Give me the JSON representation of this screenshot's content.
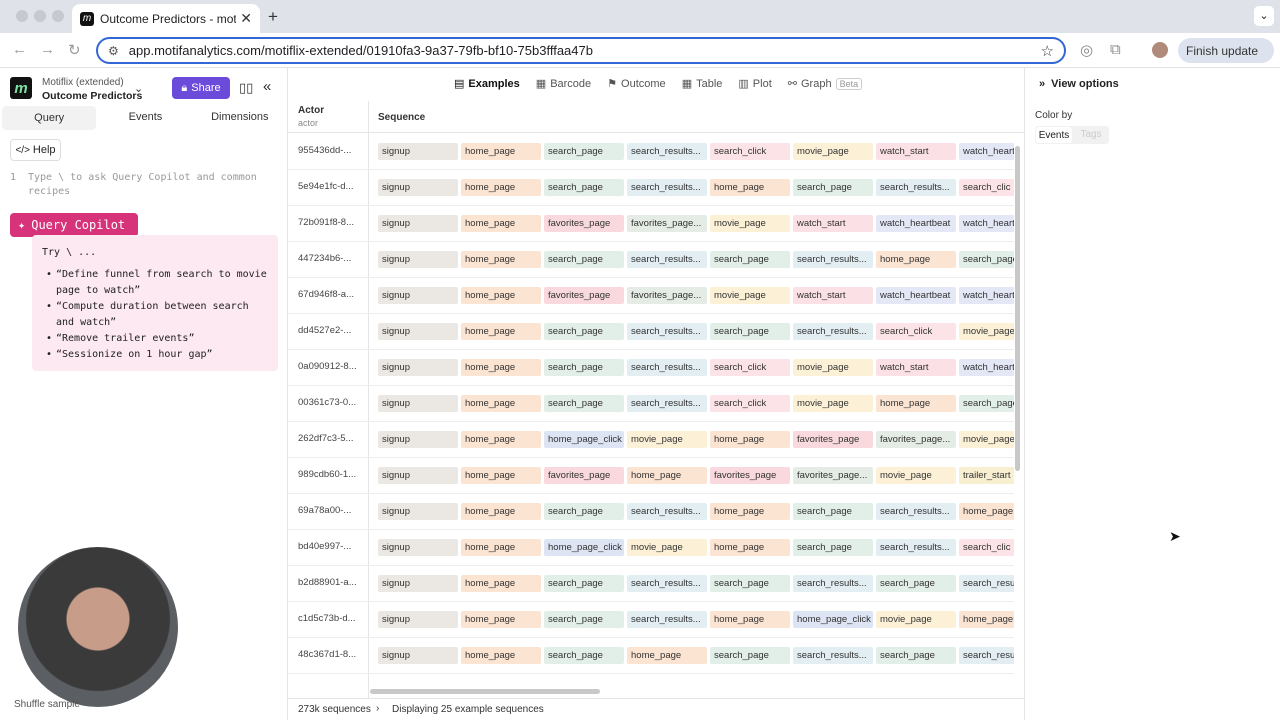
{
  "browser": {
    "tab_title": "Outcome Predictors - motifli",
    "url": "app.motifanalytics.com/motiflix-extended/01910fa3-9a37-79fb-bf10-75b3fffaa47b",
    "finish_update_label": "Finish update"
  },
  "app": {
    "project_name": "Motiflix (extended)",
    "page_title": "Outcome Predictors",
    "share_label": "Share",
    "subtabs": [
      "Query",
      "Events",
      "Dimensions"
    ],
    "help_label": "Help",
    "editor_line_number": "1",
    "editor_placeholder": "Type \\ to ask Query Copilot and common recipes",
    "copilot_label": "Query Copilot",
    "copilot_try": "Try \\ ...",
    "copilot_suggestions": [
      "“Define funnel from search to movie page to watch”",
      "“Compute duration between search and watch”",
      "“Remove trailer events”",
      "“Sessionize on 1 hour gap”"
    ],
    "shuffle_label": "Shuffle sample"
  },
  "view_tabs": [
    {
      "label": "Examples",
      "icon": "examples-icon"
    },
    {
      "label": "Barcode",
      "icon": "barcode-icon"
    },
    {
      "label": "Outcome",
      "icon": "flag-icon"
    },
    {
      "label": "Table",
      "icon": "table-icon"
    },
    {
      "label": "Plot",
      "icon": "plot-icon"
    },
    {
      "label": "Graph",
      "icon": "graph-icon",
      "badge": "Beta"
    }
  ],
  "table": {
    "actor_header": "Actor",
    "actor_subheader": "actor",
    "sequence_header": "Sequence",
    "rows": [
      {
        "actor": "955436dd-...",
        "events": [
          "signup",
          "home_page",
          "search_page",
          "search_results...",
          "search_click",
          "movie_page",
          "watch_start",
          "watch_heart"
        ]
      },
      {
        "actor": "5e94e1fc-d...",
        "events": [
          "signup",
          "home_page",
          "search_page",
          "search_results...",
          "home_page",
          "search_page",
          "search_results...",
          "search_clic"
        ]
      },
      {
        "actor": "72b091f8-8...",
        "events": [
          "signup",
          "home_page",
          "favorites_page",
          "favorites_page...",
          "movie_page",
          "watch_start",
          "watch_heartbeat",
          "watch_heart"
        ]
      },
      {
        "actor": "447234b6-...",
        "events": [
          "signup",
          "home_page",
          "search_page",
          "search_results...",
          "search_page",
          "search_results...",
          "home_page",
          "search_page"
        ]
      },
      {
        "actor": "67d946f8-a...",
        "events": [
          "signup",
          "home_page",
          "favorites_page",
          "favorites_page...",
          "movie_page",
          "watch_start",
          "watch_heartbeat",
          "watch_heart"
        ]
      },
      {
        "actor": "dd4527e2-...",
        "events": [
          "signup",
          "home_page",
          "search_page",
          "search_results...",
          "search_page",
          "search_results...",
          "search_click",
          "movie_page"
        ]
      },
      {
        "actor": "0a090912-8...",
        "events": [
          "signup",
          "home_page",
          "search_page",
          "search_results...",
          "search_click",
          "movie_page",
          "watch_start",
          "watch_heart"
        ]
      },
      {
        "actor": "00361c73-0...",
        "events": [
          "signup",
          "home_page",
          "search_page",
          "search_results...",
          "search_click",
          "movie_page",
          "home_page",
          "search_page"
        ]
      },
      {
        "actor": "262df7c3-5...",
        "events": [
          "signup",
          "home_page",
          "home_page_click",
          "movie_page",
          "home_page",
          "favorites_page",
          "favorites_page...",
          "movie_page"
        ]
      },
      {
        "actor": "989cdb60-1...",
        "events": [
          "signup",
          "home_page",
          "favorites_page",
          "home_page",
          "favorites_page",
          "favorites_page...",
          "movie_page",
          "trailer_start"
        ]
      },
      {
        "actor": "69a78a00-...",
        "events": [
          "signup",
          "home_page",
          "search_page",
          "search_results...",
          "home_page",
          "search_page",
          "search_results...",
          "home_page"
        ]
      },
      {
        "actor": "bd40e997-...",
        "events": [
          "signup",
          "home_page",
          "home_page_click",
          "movie_page",
          "home_page",
          "search_page",
          "search_results...",
          "search_clic"
        ]
      },
      {
        "actor": "b2d88901-a...",
        "events": [
          "signup",
          "home_page",
          "search_page",
          "search_results...",
          "search_page",
          "search_results...",
          "search_page",
          "search_resu"
        ]
      },
      {
        "actor": "c1d5c73b-d...",
        "events": [
          "signup",
          "home_page",
          "search_page",
          "search_results...",
          "home_page",
          "home_page_click",
          "movie_page",
          "home_page"
        ]
      },
      {
        "actor": "48c367d1-8...",
        "events": [
          "signup",
          "home_page",
          "search_page",
          "home_page",
          "search_page",
          "search_results...",
          "search_page",
          "search_resu"
        ]
      }
    ]
  },
  "event_colors": {
    "signup": "#ebe7e3",
    "home_page": "#fbe4d2",
    "search_page": "#e2efe9",
    "search_results": "#e2eef2",
    "search_click": "#fbe3e7",
    "movie_page": "#fcf1d6",
    "watch_start": "#fbe0e5",
    "watch_heartbeat": "#e4e7f5",
    "watch_heart": "#e4e7f5",
    "favorites_page": "#f9d9dd",
    "favorites_page...": "#e5ece6",
    "home_page_click": "#dde4f3",
    "trailer_start": "#f7efcf",
    "search_clic": "#fbe3e7",
    "search_resu": "#e2eef2"
  },
  "footer": {
    "sequences_count": "273k sequences",
    "displaying": "Displaying 25 example sequences"
  },
  "right_panel": {
    "view_options_label": "View options",
    "color_by_label": "Color by",
    "color_by_options": [
      "Events",
      "Tags"
    ]
  }
}
